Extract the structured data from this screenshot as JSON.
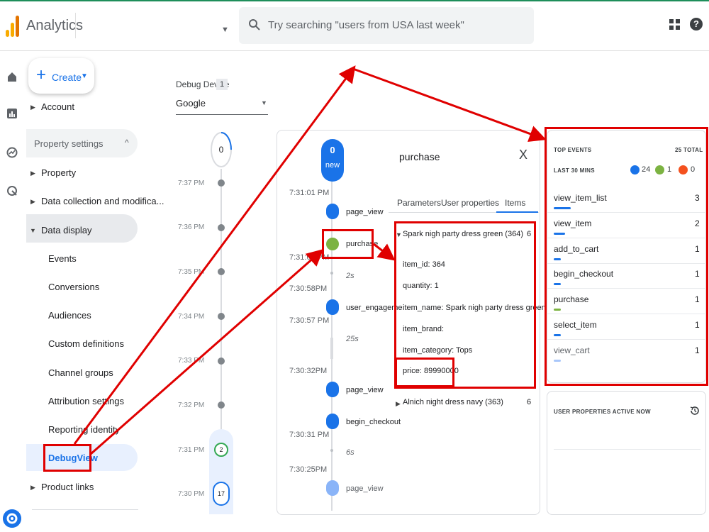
{
  "header": {
    "app_name": "Analytics",
    "search_placeholder": "Try searching \"users from USA last week\"",
    "help_glyph": "?"
  },
  "sidebar": {
    "create_label": "Create",
    "account": "Account",
    "property_settings": "Property settings",
    "items": [
      {
        "label": "Property",
        "expanded": false
      },
      {
        "label": "Data collection and modifica...",
        "expanded": false
      },
      {
        "label": "Data display",
        "expanded": true
      }
    ],
    "sub_items": [
      "Events",
      "Conversions",
      "Audiences",
      "Custom definitions",
      "Channel groups",
      "Attribution settings",
      "Reporting identity",
      "DebugView"
    ],
    "product_links": "Product links"
  },
  "debug_device": {
    "label": "Debug Device",
    "count": "1",
    "selected": "Google"
  },
  "minutes_stream": {
    "top_count": "0",
    "times": [
      "7:37 PM",
      "7:36 PM",
      "7:35 PM",
      "7:34 PM",
      "7:33 PM",
      "7:32 PM",
      "7:31 PM",
      "7:30 PM"
    ],
    "badge_731": "2",
    "badge_730": "17"
  },
  "seconds_stream": {
    "top_count": "0",
    "top_label": "new",
    "times": [
      "7:31:01 PM",
      "7:31:00 PM",
      "7:30:58PM",
      "7:30:57 PM",
      "7:30:32PM",
      "7:30:31 PM",
      "7:30:25PM"
    ],
    "events": [
      "page_view",
      "purchase",
      "user_engageme",
      "page_view",
      "begin_checkout",
      "page_view"
    ],
    "gaps": [
      "2s",
      "25s",
      "6s"
    ]
  },
  "details": {
    "title": "purchase",
    "close": "X",
    "tabs": [
      "Parameters",
      "User properties",
      "Items"
    ],
    "item1_head": "Spark nigh party dress green (364)",
    "item1_count": "6",
    "fields": [
      "item_id: 364",
      "quantity: 1",
      "item_name: Spark nigh party dress green",
      "item_brand:",
      "item_category: Tops",
      "price: 89990000"
    ],
    "item2_head": "Alnich night dress navy (363)",
    "item2_count": "6"
  },
  "top_events": {
    "title": "TOP EVENTS",
    "total": "25 TOTAL",
    "subtitle": "LAST 30 MINS",
    "count_blue": "24",
    "count_green": "1",
    "count_orange": "0",
    "rows": [
      {
        "name": "view_item_list",
        "count": "3",
        "fill": 0.12,
        "color": "#1a73e8"
      },
      {
        "name": "view_item",
        "count": "2",
        "fill": 0.08,
        "color": "#1a73e8"
      },
      {
        "name": "add_to_cart",
        "count": "1",
        "fill": 0.04,
        "color": "#1a73e8"
      },
      {
        "name": "begin_checkout",
        "count": "1",
        "fill": 0.04,
        "color": "#1a73e8"
      },
      {
        "name": "purchase",
        "count": "1",
        "fill": 0.04,
        "color": "#7cb342"
      },
      {
        "name": "select_item",
        "count": "1",
        "fill": 0.04,
        "color": "#1a73e8"
      },
      {
        "name": "view_cart",
        "count": "1",
        "fill": 0.04,
        "color": "#a8c7fa"
      }
    ]
  },
  "user_properties": {
    "title": "USER PROPERTIES ACTIVE NOW"
  },
  "colors": {
    "accent": "#1a73e8",
    "conversion": "#7cb342",
    "annotation": "#e00000"
  }
}
